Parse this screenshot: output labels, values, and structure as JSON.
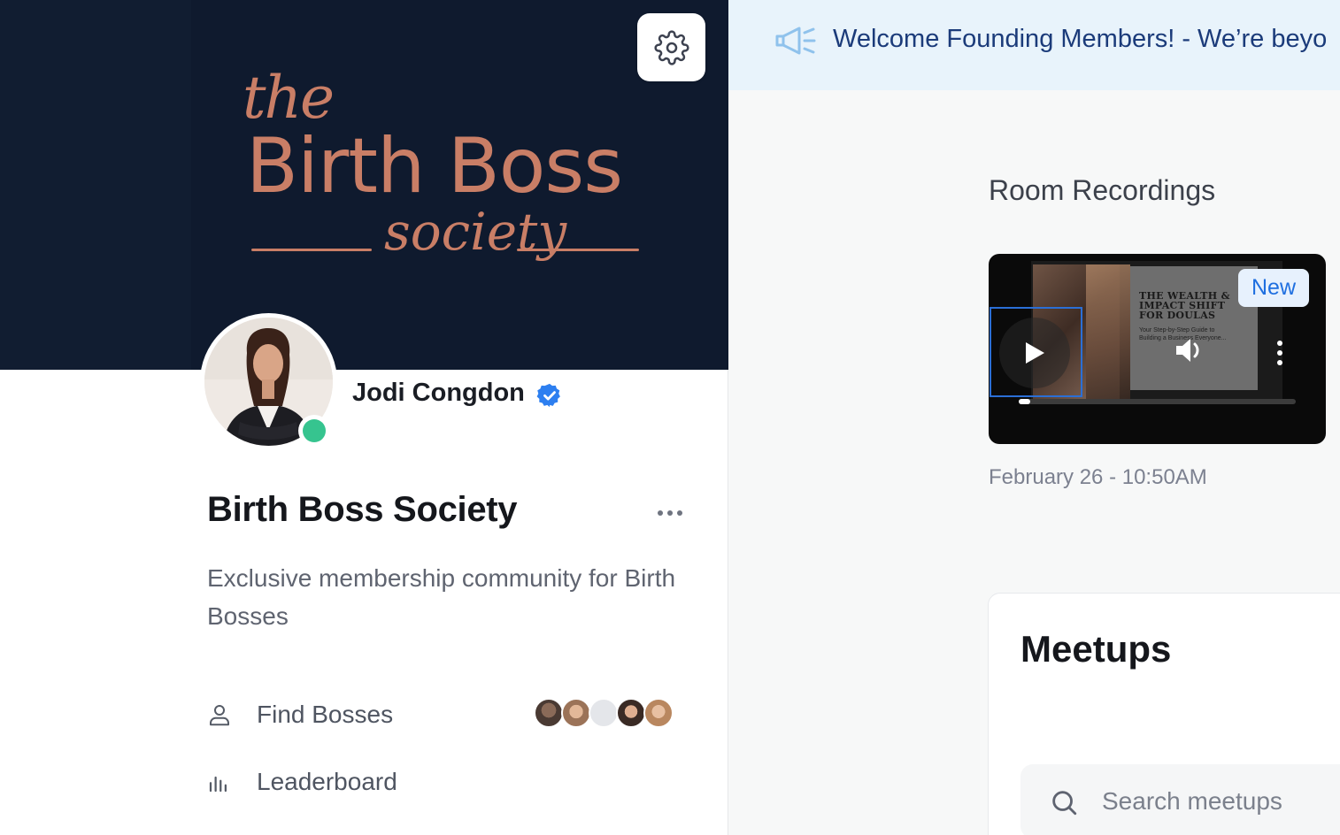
{
  "banner": {
    "logo_the": "the",
    "logo_main": "Birth Boss",
    "logo_society": "society",
    "brand_color": "#c97e66",
    "background": "#0f1a2e"
  },
  "header": {
    "settings_icon": "gear-icon"
  },
  "owner": {
    "name": "Jodi Congdon",
    "verified_icon": "verified-badge-icon",
    "status": "online"
  },
  "community": {
    "title": "Birth Boss Society",
    "description": "Exclusive membership community for Birth Bosses",
    "more_icon": "more-horizontal-icon"
  },
  "nav": {
    "items": [
      {
        "label": "Find Bosses",
        "icon": "person-icon"
      },
      {
        "label": "Leaderboard",
        "icon": "bar-chart-icon"
      }
    ]
  },
  "announcement": {
    "icon": "megaphone-icon",
    "text": "Welcome Founding Members! - We’re beyo"
  },
  "recordings": {
    "title": "Room Recordings",
    "items": [
      {
        "badge": "New",
        "date": "February 26 - 10:50AM",
        "slide_title": "THE WEALTH & IMPACT SHIFT FOR DOULAS",
        "slide_subtitle": "Your Step-by-Step Guide to Building a Business Everyone...",
        "progress": 0.04
      }
    ]
  },
  "meetups": {
    "title": "Meetups",
    "search_placeholder": "Search meetups"
  }
}
